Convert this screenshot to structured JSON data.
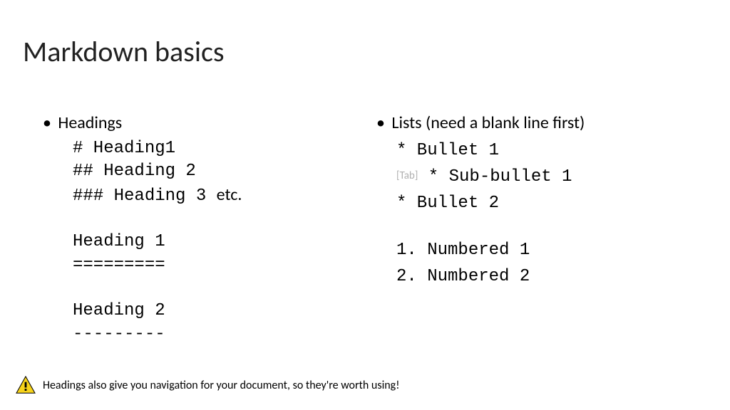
{
  "title": "Markdown basics",
  "left": {
    "heading": "Headings",
    "lines": {
      "h1": "# Heading1",
      "h2": "## Heading 2",
      "h3": "### Heading 3 ",
      "etc": "etc.",
      "alt_h1_text": "Heading 1",
      "alt_h1_rule": "=========",
      "alt_h2_text": "Heading 2",
      "alt_h2_rule": "---------"
    }
  },
  "right": {
    "heading": "Lists (need a blank line first)",
    "lines": {
      "b1": "* Bullet 1",
      "tab_hint": "[Tab]",
      "sub1": " * Sub-bullet 1",
      "b2": "* Bullet 2",
      "n1": "1. Numbered 1",
      "n2": "2. Numbered 2"
    }
  },
  "footer": {
    "text": "Headings also give you navigation for your document, so they're worth using!"
  }
}
